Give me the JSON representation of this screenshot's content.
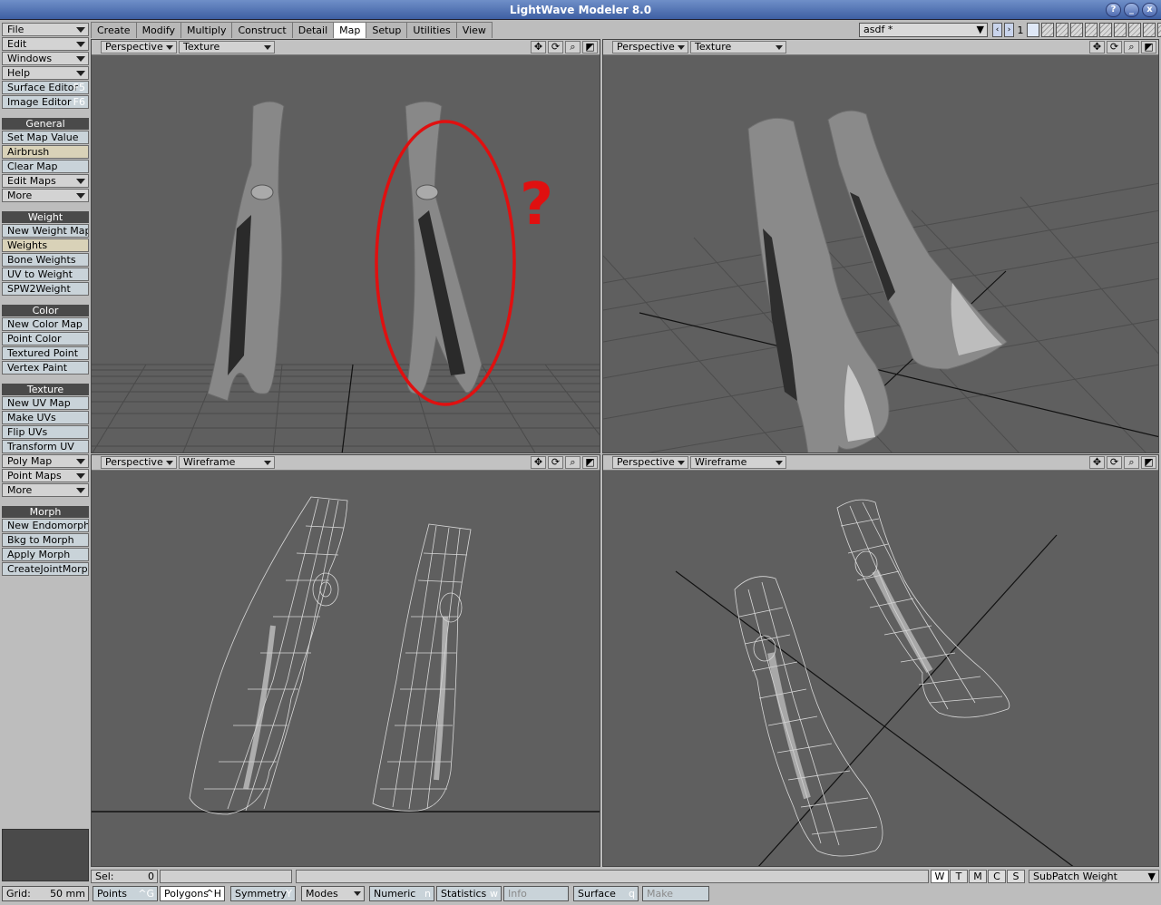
{
  "window": {
    "title": "LightWave Modeler 8.0",
    "buttons": [
      "?",
      "_",
      "x"
    ]
  },
  "tabs": [
    "Create",
    "Modify",
    "Multiply",
    "Construct",
    "Detail",
    "Map",
    "Setup",
    "Utilities",
    "View"
  ],
  "active_tab": "Map",
  "object_selector": "asdf *",
  "layer_number": "1",
  "sidebar": {
    "top": [
      "File",
      "Edit",
      "Windows",
      "Help"
    ],
    "surface_editor": {
      "label": "Surface Editor",
      "key": "F5"
    },
    "image_editor": {
      "label": "Image Editor",
      "key": "F6"
    },
    "general": {
      "title": "General",
      "items": [
        "Set Map Value",
        "Airbrush",
        "Clear Map",
        "Edit Maps",
        "More"
      ]
    },
    "weight": {
      "title": "Weight",
      "items": [
        "New Weight Map",
        "Weights",
        "Bone Weights",
        "UV to Weight",
        "SPW2Weight"
      ]
    },
    "color": {
      "title": "Color",
      "items": [
        "New Color Map",
        "Point Color",
        "Textured Point",
        "Vertex Paint"
      ]
    },
    "texture": {
      "title": "Texture",
      "items": [
        "New UV Map",
        "Make UVs",
        "Flip UVs",
        "Transform UV",
        "Poly Map",
        "Point Maps",
        "More"
      ]
    },
    "morph": {
      "title": "Morph",
      "items": [
        "New Endomorph",
        "Bkg to Morph",
        "Apply Morph",
        "CreateJointMorph"
      ]
    }
  },
  "viewports": [
    {
      "view": "Perspective",
      "mode": "Texture"
    },
    {
      "view": "Perspective",
      "mode": "Texture"
    },
    {
      "view": "Perspective",
      "mode": "Wireframe"
    },
    {
      "view": "Perspective",
      "mode": "Wireframe"
    }
  ],
  "viewport_icons": [
    "move-icon",
    "rotate-icon",
    "zoom-icon",
    "maximize-icon"
  ],
  "annotation": {
    "text": "?",
    "color": "#e01010"
  },
  "status": {
    "sel_label": "Sel:",
    "sel_value": "0",
    "wtmcs": [
      "W",
      "T",
      "M",
      "C",
      "S"
    ],
    "map_type": "SubPatch Weight"
  },
  "bottom": {
    "grid_label": "Grid:",
    "grid_value": "50 mm",
    "points": {
      "label": "Points",
      "key": "^G"
    },
    "polygons": {
      "label": "Polygons",
      "key": "^H"
    },
    "symmetry": {
      "label": "Symmetry",
      "key": "Y"
    },
    "modes": "Modes",
    "numeric": {
      "label": "Numeric",
      "key": "n"
    },
    "statistics": {
      "label": "Statistics",
      "key": "w"
    },
    "info": "Info",
    "surface": {
      "label": "Surface",
      "key": "q"
    },
    "make": "Make"
  }
}
